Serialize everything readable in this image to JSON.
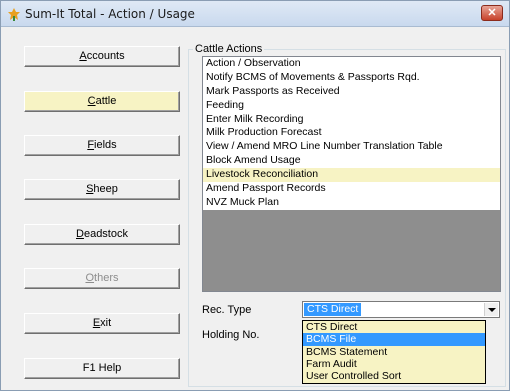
{
  "window": {
    "title": "Sum-It Total - Action / Usage",
    "close_glyph": "✕"
  },
  "nav": [
    {
      "label": "Accounts",
      "mnemonic": "A",
      "state": "normal"
    },
    {
      "label": "Cattle",
      "mnemonic": "C",
      "state": "active"
    },
    {
      "label": "Fields",
      "mnemonic": "F",
      "state": "normal"
    },
    {
      "label": "Sheep",
      "mnemonic": "S",
      "state": "normal"
    },
    {
      "label": "Deadstock",
      "mnemonic": "D",
      "state": "normal"
    },
    {
      "label": "Others",
      "mnemonic": "O",
      "state": "disabled"
    },
    {
      "label": "Exit",
      "mnemonic": "E",
      "state": "normal"
    },
    {
      "label": "F1  Help",
      "mnemonic": "",
      "state": "normal"
    }
  ],
  "actions_group": {
    "title": "Cattle Actions",
    "items": [
      "Action / Observation",
      "Notify BCMS of Movements & Passports Rqd.",
      "Mark Passports as Received",
      "Feeding",
      "Enter Milk Recording",
      "Milk Production Forecast",
      "View / Amend MRO Line Number Translation Table",
      "Block Amend Usage",
      "Livestock Reconciliation",
      "Amend Passport Records",
      "NVZ Muck Plan"
    ],
    "highlighted_index": 8
  },
  "rec_type": {
    "label": "Rec. Type",
    "value": "CTS Direct",
    "options": [
      "CTS Direct",
      "BCMS File",
      "BCMS Statement",
      "Farm Audit",
      "User Controlled Sort"
    ],
    "selected_option_index": 1
  },
  "holding": {
    "label": "Holding No."
  },
  "colors": {
    "highlight_yellow": "#f7f3c4",
    "selection_blue": "#3399ff",
    "list_empty_gray": "#8e8e8e"
  }
}
